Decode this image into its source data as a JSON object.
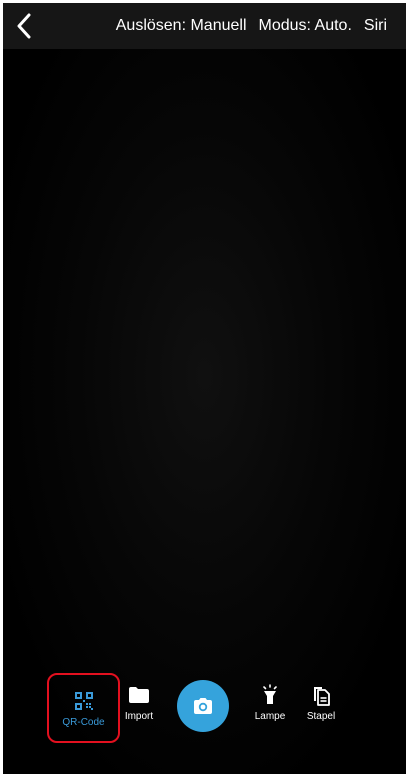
{
  "header": {
    "back_icon": "chevron-left-icon",
    "trigger_label": "Auslösen: Manuell",
    "mode_label": "Modus: Auto.",
    "siri_label": "Siri"
  },
  "toolbar": {
    "qr_label": "QR-Code",
    "qr_icon": "qr-code-icon",
    "import_label": "Import",
    "import_icon": "folder-icon",
    "shutter_icon": "camera-icon",
    "lamp_label": "Lampe",
    "lamp_icon": "flashlight-icon",
    "stapel_label": "Stapel",
    "stapel_icon": "documents-stack-icon"
  },
  "colors": {
    "accent": "#35a3dc",
    "highlight": "#e3101f",
    "background": "#000000"
  }
}
